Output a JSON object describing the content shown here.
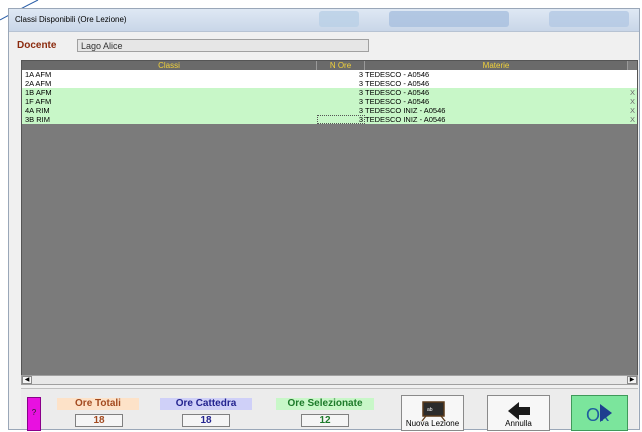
{
  "window": {
    "title": "Classi Disponibili (Ore Lezione)"
  },
  "docente": {
    "label": "Docente",
    "value": "Lago Alice"
  },
  "grid": {
    "columns": [
      "Classi",
      "N Ore",
      "Materie"
    ],
    "rows": [
      {
        "classe": "1A AFM",
        "ore": "3",
        "materia": "TEDESCO - A0546",
        "selected": false,
        "mark": ""
      },
      {
        "classe": "2A AFM",
        "ore": "3",
        "materia": "TEDESCO - A0546",
        "selected": false,
        "mark": ""
      },
      {
        "classe": "1B AFM",
        "ore": "3",
        "materia": "TEDESCO - A0546",
        "selected": true,
        "mark": "X"
      },
      {
        "classe": "1F AFM",
        "ore": "3",
        "materia": "TEDESCO - A0546",
        "selected": true,
        "mark": "X"
      },
      {
        "classe": "4A RIM",
        "ore": "3",
        "materia": "TEDESCO INIZ - A0546",
        "selected": true,
        "mark": "X"
      },
      {
        "classe": "3B RIM",
        "ore": "3",
        "materia": "TEDESCO INIZ - A0546",
        "selected": true,
        "mark": "X"
      }
    ]
  },
  "stats": {
    "ore_totali": {
      "label": "Ore Totali",
      "value": "18",
      "color": "#fde2c8",
      "text_color": "#a34a1f"
    },
    "ore_cattedra": {
      "label": "Ore Cattedra",
      "value": "18",
      "color": "#cfd0f8",
      "text_color": "#23238f"
    },
    "ore_selezionate": {
      "label": "Ore Selezionate",
      "value": "12",
      "color": "#c8f7c8",
      "text_color": "#1d7a2a"
    }
  },
  "buttons": {
    "help": "?",
    "nuova_lezione": "Nuova Lezione",
    "annulla": "Annulla",
    "ok": "Ok"
  },
  "icons": {
    "nuova_lezione": "blackboard-icon",
    "annulla": "back-arrow-icon",
    "ok": "forward-arrow-icon"
  }
}
